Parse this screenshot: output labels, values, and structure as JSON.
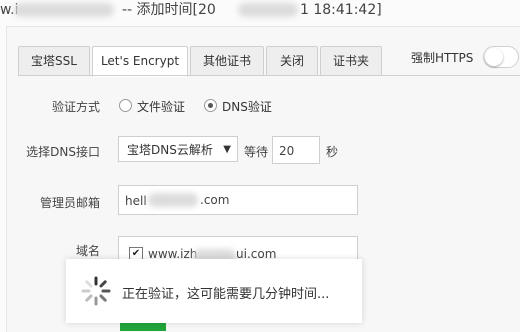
{
  "title_bar": {
    "prefix": "w.i",
    "middle": "-- 添加时间[20",
    "time": "1 18:41:42]"
  },
  "tabs": [
    {
      "label": "宝塔SSL",
      "active": false
    },
    {
      "label": "Let's Encrypt",
      "active": true
    },
    {
      "label": "其他证书",
      "active": false
    },
    {
      "label": "关闭",
      "active": false
    },
    {
      "label": "证书夹",
      "active": false
    }
  ],
  "force_https": {
    "label": "强制HTTPS",
    "enabled": false
  },
  "form": {
    "verify_method_label": "验证方式",
    "verify_options": [
      {
        "label": "文件验证",
        "checked": false
      },
      {
        "label": "DNS验证",
        "checked": true
      }
    ],
    "dns_label": "选择DNS接口",
    "dns_selected": "宝塔DNS云解析",
    "wait_label": "等待",
    "wait_value": "20",
    "seconds_label": "秒",
    "email_label": "管理员邮箱",
    "email_prefix": "hell",
    "email_suffix": ".com",
    "domain_label": "域名",
    "domain_prefix": "www.izh",
    "domain_suffix": "ui.com"
  },
  "loading": {
    "text": "正在验证，这可能需要几分钟时间..."
  },
  "colors": {
    "accent": "#20a53a",
    "border": "#cfcfcf"
  }
}
